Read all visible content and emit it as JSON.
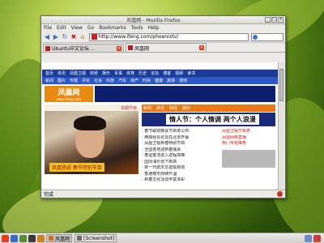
{
  "window": {
    "title": "凤凰网 - Mozilla Firefox",
    "controls": [
      "_",
      "□",
      "×"
    ]
  },
  "menubar": [
    "File",
    "Edit",
    "View",
    "Go",
    "Bookmarks",
    "Tools",
    "Help"
  ],
  "navbar": {
    "url": "http://www.ifeng.com/phoenixtv/",
    "search_placeholder": ""
  },
  "tabs": [
    {
      "label": "Ubuntu中文论坛 ...",
      "active": false
    },
    {
      "label": "凤凰网",
      "active": true
    }
  ],
  "page": {
    "nav1": [
      "首页",
      "资讯",
      "凤凰卫视",
      "财经",
      "娱乐",
      "军事",
      "体育",
      "历史",
      "论坛",
      "博客",
      "视频",
      "读书"
    ],
    "nav2": [
      "新闻",
      "图片",
      "专题",
      "评论",
      "社会",
      "科技",
      "汽车",
      "房产",
      "时尚",
      "健康",
      "旅游",
      "游戏"
    ],
    "logo_big": "凤凰网",
    "logo_small": "www.ifeng.com",
    "left_head": "本期节目",
    "photo_caption": "凤凰热线 春节特别节目",
    "orange_bar": [
      "新闻",
      "资讯",
      "财经",
      "娱乐"
    ],
    "headline": "情人节：个人情调 两个人浪漫",
    "list": [
      "春节联欢晚会节目单公布",
      "两岸经贸论坛在北京开幕",
      "凤凰卫视新春特别节目",
      "全国各地迎新春庙会",
      "春运客流进入返程高峰",
      "国际油价创下新高",
      "新一代航天员选拔启动",
      "香港楼市持续升温",
      "新春文化活动丰富多彩"
    ],
    "side": [
      "凤凰卫视节目表",
      "凤凰网络直播",
      "热门专题推荐"
    ]
  },
  "statusbar": {
    "text": "完成"
  },
  "taskbar": {
    "tasks": [
      {
        "label": "凤凰网",
        "active": true
      },
      {
        "label": "[Screenshot]",
        "active": false
      }
    ]
  }
}
